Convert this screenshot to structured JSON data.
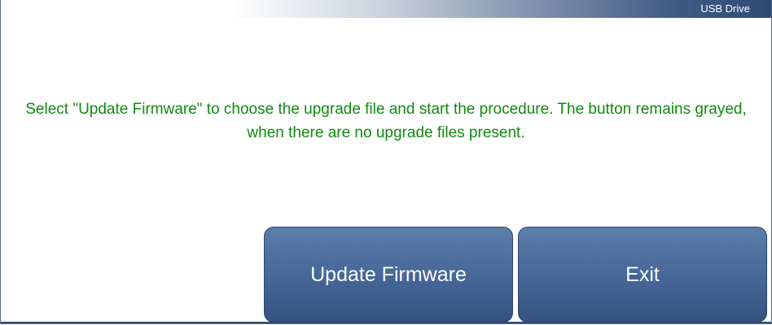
{
  "header": {
    "title": "USB Drive"
  },
  "main": {
    "message": "Select \"Update Firmware\" to choose the upgrade file and start the procedure. The button remains grayed, when there are no upgrade files present."
  },
  "buttons": {
    "update_label": "Update Firmware",
    "exit_label": "Exit"
  },
  "colors": {
    "message_text": "#0e8a0e",
    "button_background": "#47689a",
    "title_bar_dark": "#2f4a76"
  }
}
